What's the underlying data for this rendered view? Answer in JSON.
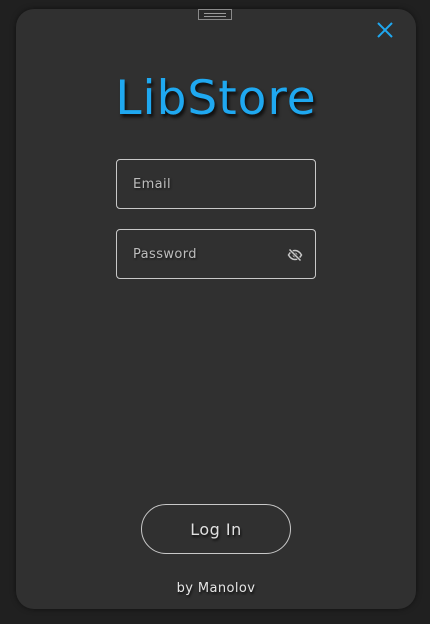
{
  "app": {
    "title": "LibStore",
    "accent_color": "#1fa8f0",
    "background_color": "#303030"
  },
  "window": {
    "drag_handle_icon": "drag-handle-icon",
    "close_icon": "close-icon"
  },
  "login_form": {
    "email": {
      "placeholder": "Email",
      "value": ""
    },
    "password": {
      "placeholder": "Password",
      "value": "",
      "visibility_icon": "eye-off-icon"
    },
    "submit_label": "Log In"
  },
  "footer": {
    "credit": "by Manolov"
  }
}
